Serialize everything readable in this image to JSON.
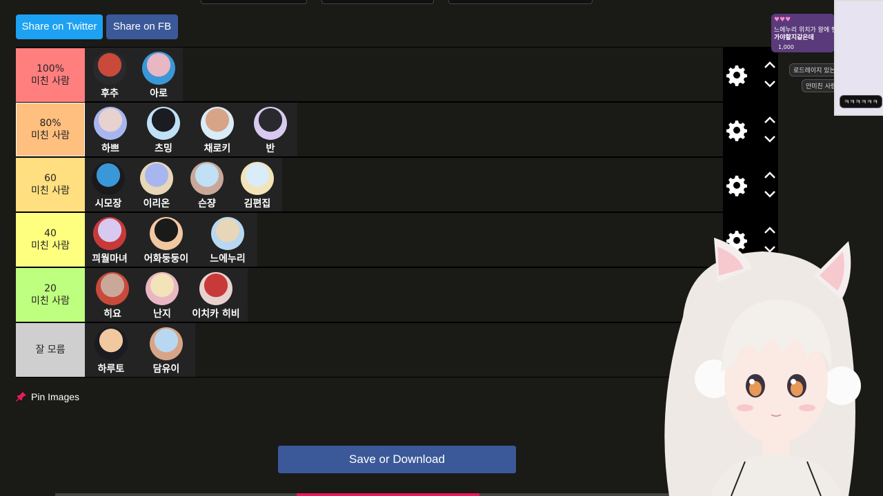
{
  "share": {
    "twitter_label": "Share on Twitter",
    "fb_label": "Share on FB"
  },
  "tiers": [
    {
      "label_line1": "100%",
      "label_line2": "미친 사람",
      "color": "#ff7f7f",
      "items": [
        "후추",
        "아로"
      ]
    },
    {
      "label_line1": "80%",
      "label_line2": "미친 사람",
      "color": "#ffbf7f",
      "items": [
        "하쁘",
        "츠밍",
        "채로키",
        "반"
      ]
    },
    {
      "label_line1": "60",
      "label_line2": "미친 사람",
      "color": "#ffdf7f",
      "items": [
        "시모장",
        "이리온",
        "슨쟝",
        "김편집"
      ]
    },
    {
      "label_line1": "40",
      "label_line2": "미친 사람",
      "color": "#ffff7f",
      "items": [
        "끠월마녀",
        "어화둥둥이",
        "느에누리"
      ]
    },
    {
      "label_line1": "20",
      "label_line2": "미친 사람",
      "color": "#bfff7f",
      "items": [
        "히요",
        "난지",
        "이치카 히비"
      ]
    },
    {
      "label_line1": "잘 모름",
      "label_line2": "",
      "color": "#cfcfcf",
      "items": [
        "하루토",
        "담유이"
      ]
    }
  ],
  "pin_label": "Pin Images",
  "save_label": "Save or Download",
  "chat": {
    "donation_count": "1,000",
    "messages": [
      "느에누리 위치가 왕에 맨들 이번야임으로",
      "가야할지같은데",
      "로드레이지 있는 위원 사람",
      "안미친 사람은 없는거다",
      "ㅋㅋㅋㅋㅋㅋ"
    ]
  },
  "colors": {
    "twitter": "#1da1f2",
    "facebook": "#3b5998",
    "pin_icon": "#e9195c"
  }
}
